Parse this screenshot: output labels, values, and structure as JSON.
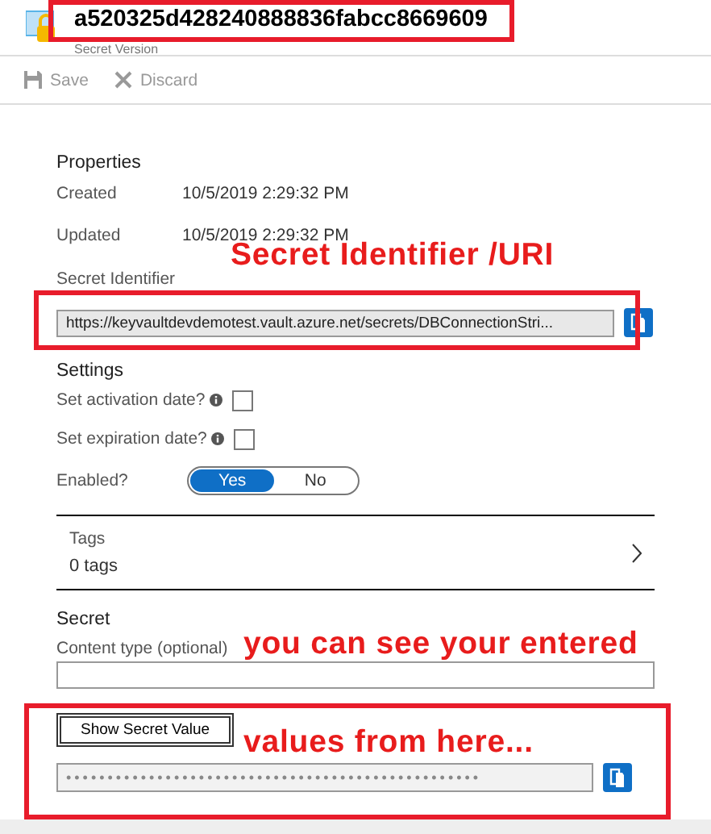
{
  "header": {
    "title": "a520325d428240888836fabcc8669609",
    "subtitle": "Secret Version"
  },
  "toolbar": [
    {
      "kind": "save",
      "label": "Save",
      "disabled": true
    },
    {
      "kind": "discard",
      "label": "Discard",
      "disabled": true
    }
  ],
  "properties": {
    "heading": "Properties",
    "rows": [
      {
        "label": "Created",
        "value": "10/5/2019 2:29:32 PM"
      },
      {
        "label": "Updated",
        "value": "10/5/2019 2:29:32 PM"
      }
    ],
    "identifier_label": "Secret Identifier",
    "identifier_value": "https://keyvaultdevdemotest.vault.azure.net/secrets/DBConnectionStri..."
  },
  "settings": {
    "heading": "Settings",
    "options": [
      {
        "label": "Set activation date?",
        "checked": false
      },
      {
        "label": "Set expiration date?",
        "checked": false
      }
    ],
    "enabled_label": "Enabled?",
    "enabled_choices": [
      {
        "label": "Yes",
        "selected": true
      },
      {
        "label": "No",
        "selected": false
      }
    ]
  },
  "tags": {
    "label": "Tags",
    "value": "0 tags"
  },
  "secret": {
    "heading": "Secret",
    "content_type_label": "Content type (optional)",
    "show_button": "Show Secret Value",
    "value": "••••••••••••••••••••••••••••••••••••••••••••••••••"
  },
  "annotations": [
    {
      "text": "Secret Identifier /URI"
    },
    {
      "text": "you can see your entered"
    },
    {
      "text": "values from here..."
    }
  ]
}
